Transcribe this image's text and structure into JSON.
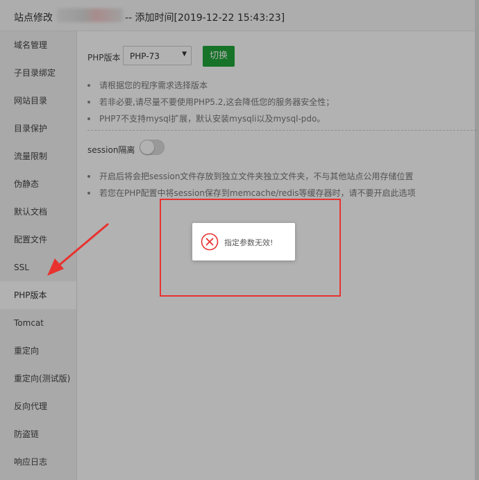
{
  "window": {
    "title_prefix": "站点修改",
    "title_suffix": "-- 添加时间[2019-12-22 15:43:23]"
  },
  "sidebar": {
    "items": [
      {
        "label": "域名管理"
      },
      {
        "label": "子目录绑定"
      },
      {
        "label": "网站目录"
      },
      {
        "label": "目录保护"
      },
      {
        "label": "流量限制"
      },
      {
        "label": "伪静态"
      },
      {
        "label": "默认文档"
      },
      {
        "label": "配置文件"
      },
      {
        "label": "SSL"
      },
      {
        "label": "PHP版本",
        "active": true
      },
      {
        "label": "Tomcat"
      },
      {
        "label": "重定向"
      },
      {
        "label": "重定向(测试版)"
      },
      {
        "label": "反向代理"
      },
      {
        "label": "防盗链"
      },
      {
        "label": "响应日志"
      }
    ]
  },
  "php": {
    "label": "PHP版本",
    "selected": "PHP-73",
    "switch_label": "切换",
    "tips": [
      "请根据您的程序需求选择版本",
      "若非必要,请尽量不要使用PHP5.2,这会降低您的服务器安全性；",
      "PHP7不支持mysql扩展，默认安装mysqli以及mysql-pdo。"
    ]
  },
  "session": {
    "label": "session隔离",
    "enabled": false,
    "tips": [
      "开启后将会把session文件存放到独立文件夹独立文件夹，不与其他站点公用存储位置",
      "若您在PHP配置中将session保存到memcache/redis等缓存器时，请不要开启此选项"
    ]
  },
  "toast": {
    "message": "指定参数无效!",
    "icon": "error-circle-icon"
  },
  "colors": {
    "accent_green": "#20a53a",
    "annotation_red": "#e8322f",
    "error_red": "#e8322f"
  }
}
